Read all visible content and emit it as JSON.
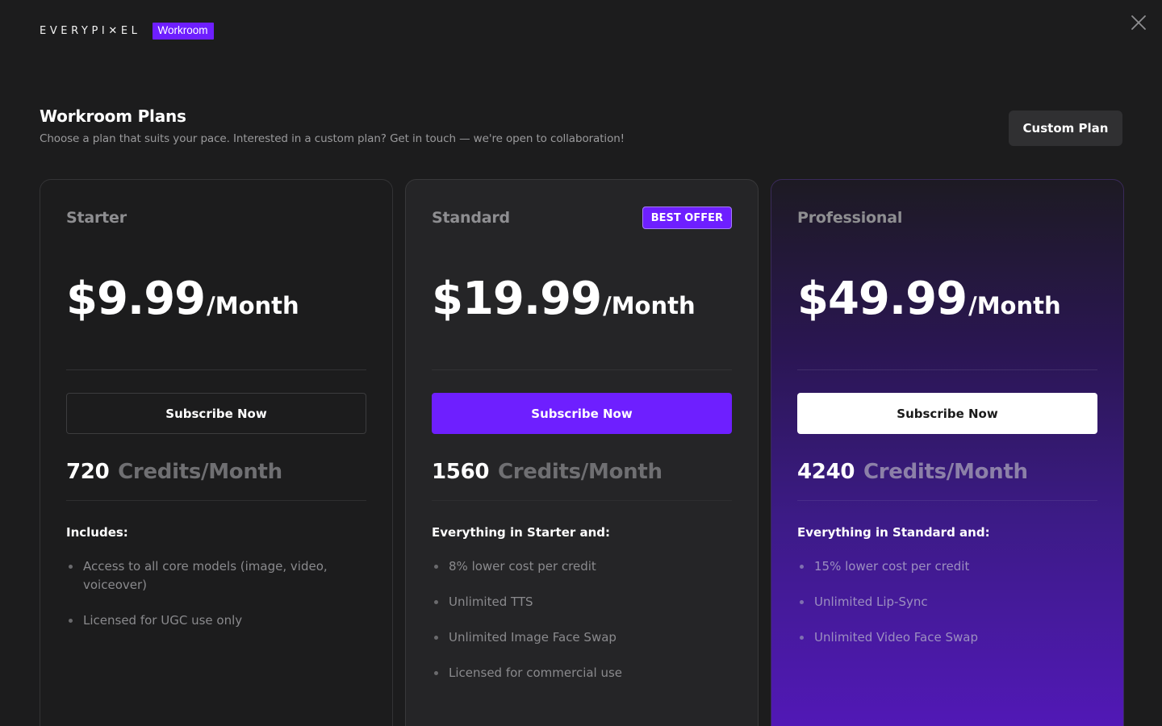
{
  "header": {
    "brand": "EVERYPI✕EL",
    "product_badge": "Workroom"
  },
  "title": "Workroom Plans",
  "subtitle": "Choose a plan that suits your pace. Interested in a custom plan? Get in touch — we're open to collaboration!",
  "custom_plan_label": "Custom Plan",
  "plans": [
    {
      "name": "Starter",
      "price": "$9.99",
      "period": "/Month",
      "cta": "Subscribe Now",
      "credits": "720",
      "credits_unit": "Credits/Month",
      "includes_heading": "Includes:",
      "features": [
        "Access to all core models (image, video, voiceover)",
        "Licensed for UGC use only"
      ]
    },
    {
      "name": "Standard",
      "badge": "BEST OFFER",
      "price": "$19.99",
      "period": "/Month",
      "cta": "Subscribe Now",
      "credits": "1560",
      "credits_unit": "Credits/Month",
      "includes_heading": "Everything in Starter and:",
      "features": [
        "8% lower cost per credit",
        "Unlimited TTS",
        "Unlimited Image Face Swap",
        "Licensed for commercial use"
      ]
    },
    {
      "name": "Professional",
      "price": "$49.99",
      "period": "/Month",
      "cta": "Subscribe Now",
      "credits": "4240",
      "credits_unit": "Credits/Month",
      "includes_heading": "Everything in Standard and:",
      "features": [
        "15% lower cost per credit",
        "Unlimited Lip-Sync",
        "Unlimited Video Face Swap"
      ]
    }
  ],
  "colors": {
    "background": "#1c1c1d",
    "accent": "#6e1fff",
    "muted_text": "#8a8a8d"
  },
  "icons": {
    "close": "close-icon"
  }
}
